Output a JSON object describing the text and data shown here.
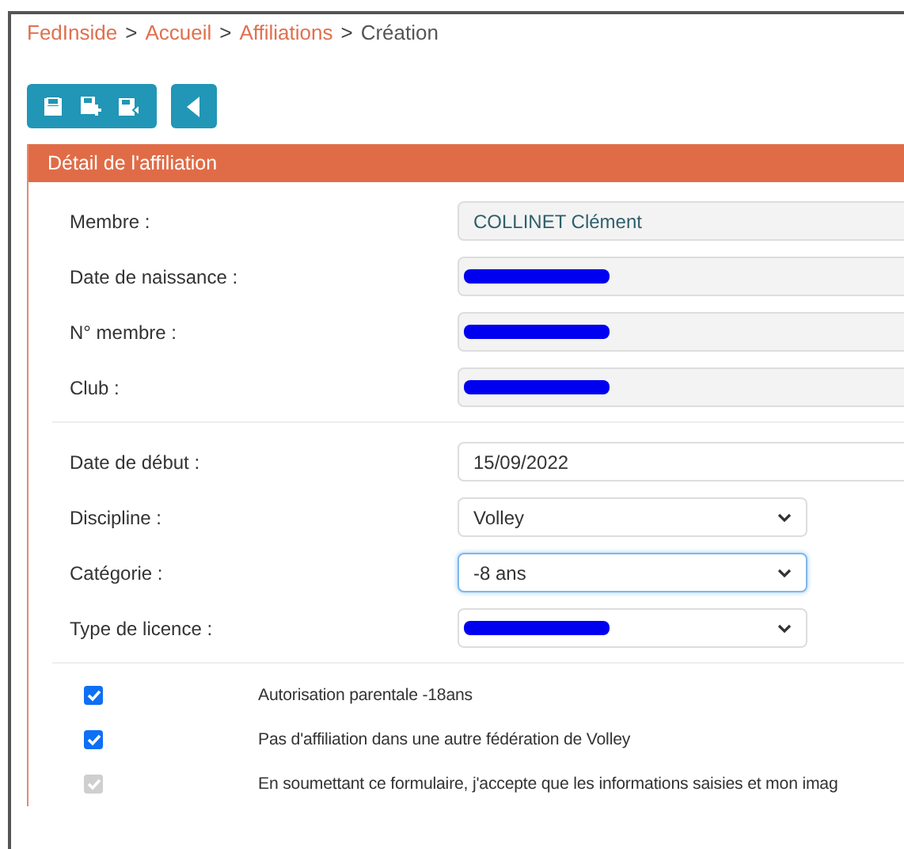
{
  "breadcrumb": [
    {
      "label": "FedInside",
      "link": true,
      "separator": ">"
    },
    {
      "label": "Accueil",
      "link": true,
      "separator": ">"
    },
    {
      "label": "Affiliations",
      "link": true,
      "separator": ">"
    },
    {
      "label": "Création",
      "link": false
    }
  ],
  "toolbar": {
    "buttons": [
      {
        "kind": "save"
      },
      {
        "kind": "save-new"
      },
      {
        "kind": "save-back"
      }
    ],
    "back": {
      "kind": "back"
    }
  },
  "panel": {
    "title": "Détail de l'affiliation",
    "sections": [
      {
        "fields": [
          {
            "label": "Membre :",
            "kind": "readonly",
            "value": "COLLINET Clément",
            "redacted": false
          },
          {
            "label": "Date de naissance :",
            "kind": "readonly",
            "redacted": true
          },
          {
            "label": "N° membre :",
            "kind": "readonly",
            "redacted": true
          },
          {
            "label": "Club :",
            "kind": "readonly",
            "redacted": true
          }
        ]
      },
      {
        "fields": [
          {
            "label": "Date de début :",
            "kind": "input",
            "value": "15/09/2022",
            "redacted": false,
            "focused": false
          },
          {
            "label": "Discipline :",
            "kind": "select",
            "value": "Volley",
            "redacted": false,
            "focused": false
          },
          {
            "label": "Catégorie :",
            "kind": "select",
            "value": "-8 ans",
            "redacted": false,
            "focused": true
          },
          {
            "label": "Type de licence :",
            "kind": "select",
            "redacted": true,
            "focused": false
          }
        ]
      }
    ],
    "checkboxes": [
      {
        "label": "Autorisation parentale -18ans",
        "checked": true,
        "disabled": false
      },
      {
        "label": "Pas d'affiliation dans une autre fédération de Volley",
        "checked": true,
        "disabled": false
      },
      {
        "label": "En soumettant ce formulaire, j'accepte que les informations saisies et mon imag",
        "checked": true,
        "disabled": true
      }
    ]
  }
}
